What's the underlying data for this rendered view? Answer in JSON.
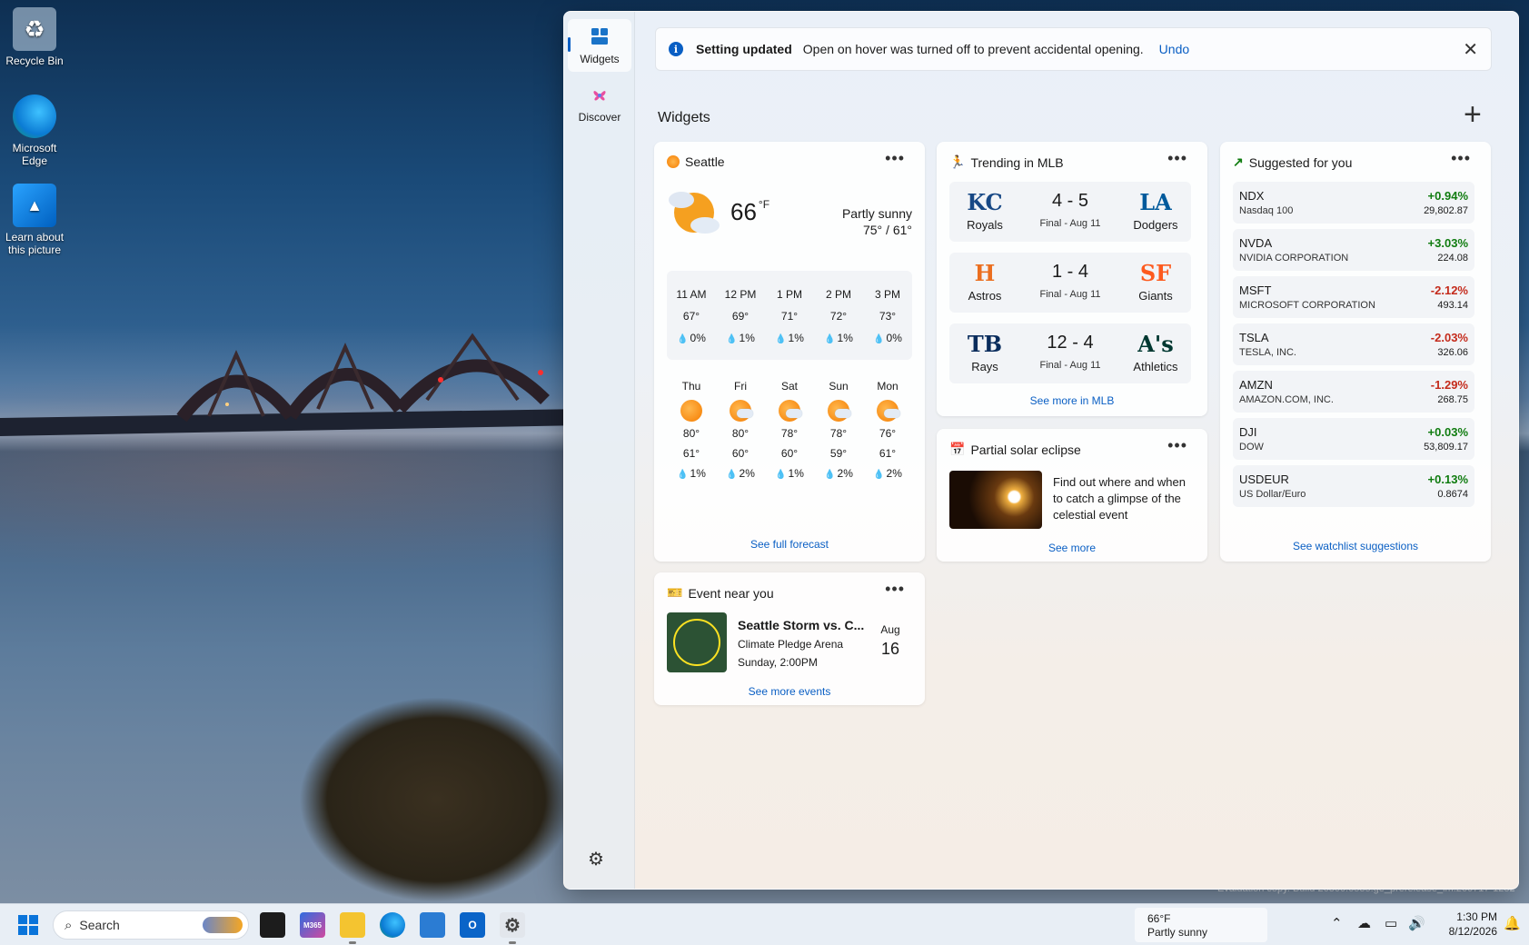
{
  "desktop": {
    "icons": [
      {
        "label": "Recycle Bin"
      },
      {
        "label": "Microsoft Edge"
      },
      {
        "label": "Learn about this picture"
      }
    ],
    "watermark": "Evaluation copy. Build 26300.6535.ge_prerelease_im.260717-1252"
  },
  "rail": {
    "widgets_label": "Widgets",
    "discover_label": "Discover"
  },
  "notification": {
    "title": "Setting updated",
    "message": "Open on hover was turned off to prevent accidental opening.",
    "undo": "Undo"
  },
  "widgets_title": "Widgets",
  "weather": {
    "location": "Seattle",
    "temp": "66",
    "unit": "°F",
    "condition": "Partly sunny",
    "hilo": "75° / 61°",
    "hourly": [
      {
        "time": "11 AM",
        "temp": "67°",
        "precip": "0%"
      },
      {
        "time": "12 PM",
        "temp": "69°",
        "precip": "1%"
      },
      {
        "time": "1 PM",
        "temp": "71°",
        "precip": "1%"
      },
      {
        "time": "2 PM",
        "temp": "72°",
        "precip": "1%"
      },
      {
        "time": "3 PM",
        "temp": "73°",
        "precip": "0%"
      }
    ],
    "daily": [
      {
        "day": "Thu",
        "high": "80°",
        "low": "61°",
        "precip": "1%",
        "icon": "sunny-icon"
      },
      {
        "day": "Fri",
        "high": "80°",
        "low": "60°",
        "precip": "2%",
        "icon": "partly-sunny-icon"
      },
      {
        "day": "Sat",
        "high": "78°",
        "low": "60°",
        "precip": "1%",
        "icon": "partly-sunny-icon"
      },
      {
        "day": "Sun",
        "high": "78°",
        "low": "59°",
        "precip": "2%",
        "icon": "partly-sunny-icon"
      },
      {
        "day": "Mon",
        "high": "76°",
        "low": "61°",
        "precip": "2%",
        "icon": "partly-sunny-icon"
      }
    ],
    "footer": "See full forecast"
  },
  "mlb": {
    "title": "Trending in MLB",
    "games": [
      {
        "home": "Royals",
        "home_logo": "KC",
        "away": "Dodgers",
        "away_logo": "LA",
        "score": "4 - 5",
        "status": "Final - Aug 11",
        "home_color": "#174885",
        "away_color": "#005a9c"
      },
      {
        "home": "Astros",
        "home_logo": "H",
        "away": "Giants",
        "away_logo": "SF",
        "score": "1 - 4",
        "status": "Final - Aug 11",
        "home_color": "#eb6e1f",
        "away_color": "#fd5a1e"
      },
      {
        "home": "Rays",
        "home_logo": "TB",
        "away": "Athletics",
        "away_logo": "A's",
        "score": "12 - 4",
        "status": "Final - Aug 11",
        "home_color": "#092c5c",
        "away_color": "#003831"
      }
    ],
    "footer": "See more in MLB"
  },
  "eclipse": {
    "title": "Partial solar eclipse",
    "body": "Find out where and when to catch a glimpse of the celestial event",
    "footer": "See more"
  },
  "stocks": {
    "title": "Suggested for you",
    "items": [
      {
        "symbol": "NDX",
        "name": "Nasdaq 100",
        "change": "+0.94%",
        "price": "29,802.87",
        "dir": "up"
      },
      {
        "symbol": "NVDA",
        "name": "NVIDIA CORPORATION",
        "change": "+3.03%",
        "price": "224.08",
        "dir": "up"
      },
      {
        "symbol": "MSFT",
        "name": "MICROSOFT CORPORATION",
        "change": "-2.12%",
        "price": "493.14",
        "dir": "down"
      },
      {
        "symbol": "TSLA",
        "name": "TESLA, INC.",
        "change": "-2.03%",
        "price": "326.06",
        "dir": "down"
      },
      {
        "symbol": "AMZN",
        "name": "AMAZON.COM, INC.",
        "change": "-1.29%",
        "price": "268.75",
        "dir": "down"
      },
      {
        "symbol": "DJI",
        "name": "DOW",
        "change": "+0.03%",
        "price": "53,809.17",
        "dir": "up"
      },
      {
        "symbol": "USDEUR",
        "name": "US Dollar/Euro",
        "change": "+0.13%",
        "price": "0.8674",
        "dir": "up"
      }
    ],
    "footer": "See watchlist suggestions"
  },
  "event": {
    "title": "Event near you",
    "name": "Seattle Storm vs. C...",
    "venue": "Climate Pledge Arena",
    "when": "Sunday, 2:00PM",
    "month": "Aug",
    "day": "16",
    "footer": "See more events"
  },
  "taskbar": {
    "search_placeholder": "Search",
    "weather_temp": "66°F",
    "weather_cond": "Partly sunny",
    "time": "1:30 PM",
    "date": "8/12/2026"
  }
}
